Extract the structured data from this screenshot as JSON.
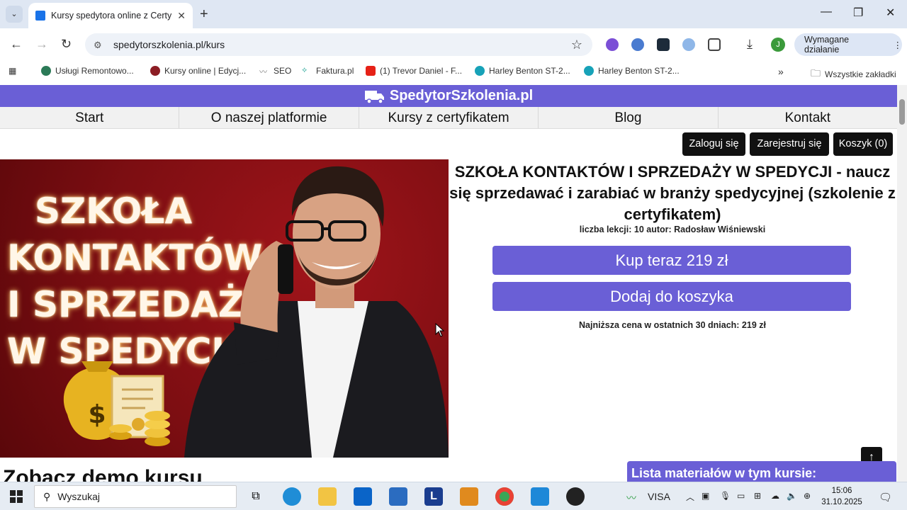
{
  "browser": {
    "tab_title": "Kursy spedytora online z Certyfi",
    "url": "spedytorszkolenia.pl/kurs",
    "action_pill": "Wymagane działanie",
    "profile_initial": "J",
    "bookmarks": [
      "Usługi Remontowo...",
      "Kursy online | Edycj...",
      "SEO",
      "Faktura.pl",
      "(1) Trevor Daniel - F...",
      "Harley Benton ST-2...",
      "Harley Benton ST-2..."
    ],
    "bookmarks_more": "»",
    "all_bookmarks": "Wszystkie zakładki"
  },
  "site": {
    "brand": "SpedytorSzkolenia.pl",
    "nav": [
      "Start",
      "O naszej platformie",
      "Kursy z certyfikatem",
      "Blog",
      "Kontakt"
    ],
    "login": "Zaloguj się",
    "register": "Zarejestruj się",
    "cart": "Koszyk (0)",
    "hero_lines": [
      "SZKOŁA",
      "KONTAKTÓW",
      "I SPRZEDAŻY",
      "W SPEDYCJI"
    ],
    "course_title": "SZKOŁA KONTAKTÓW I SPRZEDAŻY W SPEDYCJI - naucz się sprzedawać i zarabiać w branży spedycyjnej (szkolenie z certyfikatem)",
    "meta": "liczba lekcji: 10 autor: Radosław Wiśniewski",
    "buy_now": "Kup teraz 219 zł",
    "add_to_cart": "Dodaj do koszyka",
    "lowest_price": "Najniższa cena w ostatnich 30 dniach: 219 zł",
    "demo_heading": "Zobacz demo kursu",
    "materials_heading": "Lista materiałów w tym kursie:",
    "up_arrow": "↑"
  },
  "taskbar": {
    "search_placeholder": "Wyszukaj",
    "visa": "VISA",
    "time": "15:06",
    "date": "31.10.2025"
  }
}
